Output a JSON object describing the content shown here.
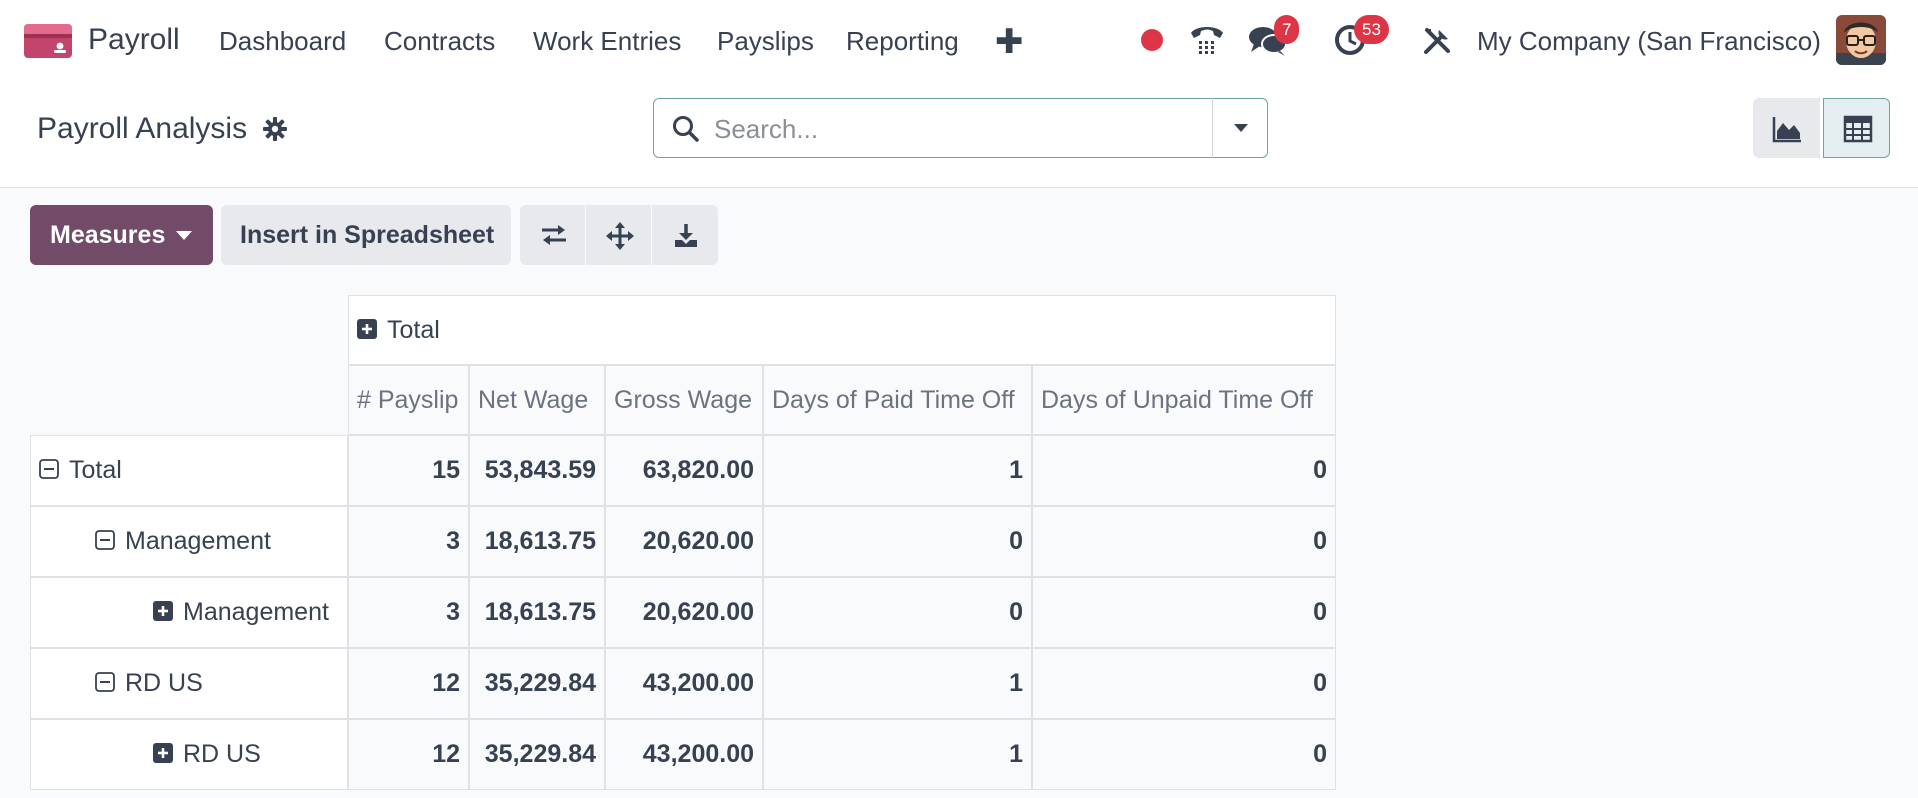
{
  "app": {
    "name": "Payroll"
  },
  "nav": {
    "items": [
      "Dashboard",
      "Contracts",
      "Work Entries",
      "Payslips",
      "Reporting"
    ],
    "plus": "✚"
  },
  "systray": {
    "messages_badge": "7",
    "activities_badge": "53",
    "company": "My Company (San Francisco)"
  },
  "control": {
    "title": "Payroll Analysis",
    "search_placeholder": "Search..."
  },
  "toolbar": {
    "measures_label": "Measures",
    "insert_label": "Insert in Spreadsheet"
  },
  "pivot": {
    "col_group": "Total",
    "headers": [
      "# Payslip",
      "Net Wage",
      "Gross Wage",
      "Days of Paid Time Off",
      "Days of Unpaid Time Off"
    ],
    "rows": [
      {
        "label": "Total",
        "level": 0,
        "expanded": true,
        "values": [
          "15",
          "53,843.59",
          "63,820.00",
          "1",
          "0"
        ]
      },
      {
        "label": "Management",
        "level": 1,
        "expanded": true,
        "values": [
          "3",
          "18,613.75",
          "20,620.00",
          "0",
          "0"
        ]
      },
      {
        "label": "Management",
        "level": 2,
        "expanded": false,
        "values": [
          "3",
          "18,613.75",
          "20,620.00",
          "0",
          "0"
        ]
      },
      {
        "label": "RD US",
        "level": 1,
        "expanded": true,
        "values": [
          "12",
          "35,229.84",
          "43,200.00",
          "1",
          "0"
        ]
      },
      {
        "label": "RD US",
        "level": 2,
        "expanded": false,
        "values": [
          "12",
          "35,229.84",
          "43,200.00",
          "1",
          "0"
        ]
      }
    ]
  },
  "colors": {
    "brand": "#714b67",
    "badge": "#dc3545",
    "accent": "#6fa3a7"
  }
}
